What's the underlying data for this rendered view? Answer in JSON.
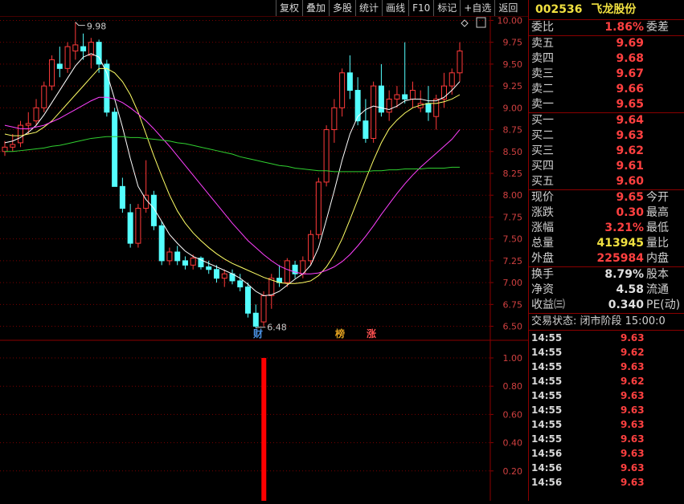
{
  "toolbar": [
    "复权",
    "叠加",
    "多股",
    "统计",
    "画线",
    "F10",
    "标记",
    "+自选",
    "返回"
  ],
  "chart": {
    "y_labels": [
      "10.00",
      "9.75",
      "9.50",
      "9.25",
      "9.00",
      "8.75",
      "8.50",
      "8.25",
      "8.00",
      "7.75",
      "7.50",
      "7.25",
      "7.00",
      "6.75",
      "6.50"
    ],
    "y_min": 6.45,
    "y_max": 10.05,
    "high_label": "9.98",
    "low_label": "6.48",
    "markers": [
      {
        "text": "财",
        "color": "#4a90e2"
      },
      {
        "text": "榜",
        "color": "#e0a020"
      },
      {
        "text": "涨",
        "color": "#ff5050"
      }
    ],
    "indicator_labels": [
      "1.00",
      "0.80",
      "0.60",
      "0.40",
      "0.20"
    ],
    "indicator_max": 1.0,
    "indicator_bar_value": 1.0,
    "indicator_color": "#ff0000",
    "ma_colors": {
      "ma5": "#ffffff",
      "ma10": "#ffff66",
      "ma20": "#ff40ff",
      "ma60": "#30d030"
    }
  },
  "chart_data": {
    "type": "candlestick",
    "note_ohlc": "open,high,low,close per session (estimated)",
    "ohlc": [
      [
        8.5,
        8.62,
        8.45,
        8.55
      ],
      [
        8.55,
        8.7,
        8.5,
        8.58
      ],
      [
        8.6,
        8.85,
        8.55,
        8.8
      ],
      [
        8.8,
        8.95,
        8.7,
        8.82
      ],
      [
        8.85,
        9.1,
        8.8,
        9.0
      ],
      [
        9.0,
        9.3,
        8.95,
        9.25
      ],
      [
        9.25,
        9.6,
        9.2,
        9.55
      ],
      [
        9.5,
        9.7,
        9.35,
        9.45
      ],
      [
        9.45,
        9.75,
        9.4,
        9.7
      ],
      [
        9.65,
        9.98,
        9.55,
        9.72
      ],
      [
        9.7,
        9.85,
        9.55,
        9.65
      ],
      [
        9.6,
        9.8,
        9.45,
        9.75
      ],
      [
        9.75,
        9.78,
        9.4,
        9.5
      ],
      [
        9.5,
        9.55,
        8.9,
        8.95
      ],
      [
        8.95,
        9.0,
        8.1,
        8.1
      ],
      [
        8.1,
        8.2,
        7.8,
        7.85
      ],
      [
        7.8,
        7.9,
        7.4,
        7.45
      ],
      [
        7.45,
        7.9,
        7.4,
        7.85
      ],
      [
        7.85,
        8.4,
        7.8,
        8.0
      ],
      [
        8.0,
        8.05,
        7.6,
        7.65
      ],
      [
        7.65,
        7.7,
        7.2,
        7.25
      ],
      [
        7.25,
        7.4,
        7.2,
        7.35
      ],
      [
        7.35,
        7.42,
        7.2,
        7.25
      ],
      [
        7.25,
        7.3,
        7.15,
        7.2
      ],
      [
        7.2,
        7.32,
        7.15,
        7.28
      ],
      [
        7.28,
        7.3,
        7.15,
        7.18
      ],
      [
        7.18,
        7.25,
        7.1,
        7.15
      ],
      [
        7.15,
        7.2,
        7.0,
        7.05
      ],
      [
        7.05,
        7.15,
        6.95,
        7.1
      ],
      [
        7.1,
        7.15,
        6.98,
        7.02
      ],
      [
        7.02,
        7.1,
        6.9,
        6.95
      ],
      [
        6.95,
        7.0,
        6.6,
        6.65
      ],
      [
        6.65,
        6.75,
        6.48,
        6.5
      ],
      [
        6.55,
        6.9,
        6.5,
        6.85
      ],
      [
        6.85,
        7.1,
        6.7,
        7.05
      ],
      [
        7.05,
        7.2,
        6.95,
        7.0
      ],
      [
        7.0,
        7.28,
        6.95,
        7.25
      ],
      [
        7.2,
        7.25,
        7.05,
        7.1
      ],
      [
        7.1,
        7.3,
        7.05,
        7.25
      ],
      [
        7.25,
        7.6,
        7.2,
        7.55
      ],
      [
        7.55,
        8.2,
        7.5,
        8.15
      ],
      [
        8.15,
        8.8,
        8.1,
        8.75
      ],
      [
        8.75,
        9.1,
        8.6,
        9.0
      ],
      [
        9.0,
        9.45,
        8.9,
        9.4
      ],
      [
        9.4,
        9.6,
        9.1,
        9.2
      ],
      [
        9.2,
        9.35,
        8.8,
        8.85
      ],
      [
        8.85,
        9.1,
        8.6,
        8.65
      ],
      [
        8.65,
        9.3,
        8.6,
        9.25
      ],
      [
        9.25,
        9.5,
        8.9,
        8.95
      ],
      [
        8.95,
        9.2,
        8.85,
        9.1
      ],
      [
        9.1,
        9.25,
        9.0,
        9.15
      ],
      [
        9.15,
        9.75,
        9.05,
        9.1
      ],
      [
        9.1,
        9.3,
        9.0,
        9.2
      ],
      [
        9.0,
        9.2,
        8.95,
        9.05
      ],
      [
        9.05,
        9.25,
        8.85,
        8.95
      ],
      [
        8.9,
        9.15,
        8.75,
        9.1
      ],
      [
        9.1,
        9.4,
        9.0,
        9.25
      ],
      [
        9.25,
        9.45,
        9.15,
        9.4
      ],
      [
        9.4,
        9.75,
        9.3,
        9.65
      ]
    ],
    "ma_series": [
      {
        "id": "ma5",
        "values": [
          8.6,
          8.62,
          8.66,
          8.72,
          8.8,
          8.92,
          9.06,
          9.2,
          9.34,
          9.48,
          9.58,
          9.62,
          9.58,
          9.4,
          9.1,
          8.78,
          8.42,
          8.1,
          7.95,
          7.85,
          7.7,
          7.55,
          7.45,
          7.36,
          7.3,
          7.26,
          7.22,
          7.18,
          7.14,
          7.1,
          7.05,
          6.98,
          6.9,
          6.85,
          6.86,
          6.9,
          6.97,
          7.04,
          7.1,
          7.2,
          7.4,
          7.72,
          8.05,
          8.4,
          8.7,
          8.9,
          8.98,
          9.02,
          9.0,
          8.98,
          9.02,
          9.08,
          9.1,
          9.1,
          9.08,
          9.08,
          9.12,
          9.2,
          9.3
        ]
      },
      {
        "id": "ma10",
        "values": [
          8.7,
          8.68,
          8.68,
          8.7,
          8.72,
          8.78,
          8.85,
          8.95,
          9.05,
          9.15,
          9.25,
          9.35,
          9.45,
          9.45,
          9.4,
          9.3,
          9.15,
          8.95,
          8.7,
          8.45,
          8.22,
          8.0,
          7.82,
          7.68,
          7.57,
          7.48,
          7.4,
          7.33,
          7.27,
          7.22,
          7.18,
          7.14,
          7.1,
          7.06,
          7.03,
          7.0,
          6.99,
          6.99,
          7.0,
          7.02,
          7.08,
          7.18,
          7.32,
          7.5,
          7.72,
          7.95,
          8.18,
          8.4,
          8.6,
          8.76,
          8.86,
          8.94,
          9.0,
          9.03,
          9.05,
          9.05,
          9.07,
          9.1,
          9.15
        ]
      },
      {
        "id": "ma20",
        "values": [
          8.8,
          8.78,
          8.76,
          8.76,
          8.78,
          8.8,
          8.84,
          8.88,
          8.93,
          8.98,
          9.03,
          9.08,
          9.12,
          9.12,
          9.1,
          9.06,
          9.0,
          8.93,
          8.85,
          8.76,
          8.66,
          8.56,
          8.45,
          8.34,
          8.23,
          8.12,
          8.01,
          7.9,
          7.79,
          7.68,
          7.58,
          7.48,
          7.4,
          7.32,
          7.25,
          7.19,
          7.15,
          7.12,
          7.1,
          7.1,
          7.11,
          7.14,
          7.18,
          7.24,
          7.32,
          7.42,
          7.53,
          7.65,
          7.78,
          7.9,
          8.02,
          8.13,
          8.23,
          8.32,
          8.4,
          8.48,
          8.56,
          8.64,
          8.75
        ]
      },
      {
        "id": "ma60",
        "values": [
          8.5,
          8.5,
          8.51,
          8.52,
          8.53,
          8.54,
          8.56,
          8.57,
          8.59,
          8.61,
          8.63,
          8.65,
          8.66,
          8.67,
          8.67,
          8.67,
          8.66,
          8.66,
          8.65,
          8.64,
          8.63,
          8.62,
          8.6,
          8.59,
          8.57,
          8.55,
          8.53,
          8.51,
          8.49,
          8.47,
          8.44,
          8.42,
          8.4,
          8.38,
          8.36,
          8.34,
          8.33,
          8.31,
          8.3,
          8.29,
          8.28,
          8.28,
          8.27,
          8.27,
          8.27,
          8.27,
          8.27,
          8.28,
          8.28,
          8.29,
          8.29,
          8.3,
          8.3,
          8.3,
          8.31,
          8.31,
          8.31,
          8.32,
          8.32
        ]
      }
    ]
  },
  "stock": {
    "code": "002536",
    "name": "飞龙股份"
  },
  "ratio": {
    "label": "委比",
    "value": "1.86%",
    "label2": "委差"
  },
  "sells": [
    {
      "label": "卖五",
      "price": "9.69"
    },
    {
      "label": "卖四",
      "price": "9.68"
    },
    {
      "label": "卖三",
      "price": "9.67"
    },
    {
      "label": "卖二",
      "price": "9.66"
    },
    {
      "label": "卖一",
      "price": "9.65"
    }
  ],
  "buys": [
    {
      "label": "买一",
      "price": "9.64"
    },
    {
      "label": "买二",
      "price": "9.63"
    },
    {
      "label": "买三",
      "price": "9.62"
    },
    {
      "label": "买四",
      "price": "9.61"
    },
    {
      "label": "买五",
      "price": "9.60"
    }
  ],
  "quote": [
    {
      "label": "现价",
      "value": "9.65",
      "label2": "今开",
      "cls": "red"
    },
    {
      "label": "涨跌",
      "value": "0.30",
      "label2": "最高",
      "cls": "red"
    },
    {
      "label": "涨幅",
      "value": "3.21%",
      "label2": "最低",
      "cls": "red"
    },
    {
      "label": "总量",
      "value": "413945",
      "label2": "量比",
      "cls": "yel"
    },
    {
      "label": "外盘",
      "value": "225984",
      "label2": "内盘",
      "cls": "red"
    }
  ],
  "fund": [
    {
      "label": "换手",
      "value": "8.79%",
      "label2": "股本"
    },
    {
      "label": "净资",
      "value": "4.58",
      "label2": "流通"
    },
    {
      "label": "收益㈢",
      "value": "0.340",
      "label2": "PE(动)"
    }
  ],
  "status": {
    "text": "交易状态: 闭市阶段 15:00:0"
  },
  "ticks": [
    {
      "time": "14:55",
      "price": "9.63"
    },
    {
      "time": "14:55",
      "price": "9.62"
    },
    {
      "time": "14:55",
      "price": "9.63"
    },
    {
      "time": "14:55",
      "price": "9.62"
    },
    {
      "time": "14:55",
      "price": "9.63"
    },
    {
      "time": "14:55",
      "price": "9.63"
    },
    {
      "time": "14:55",
      "price": "9.63"
    },
    {
      "time": "14:55",
      "price": "9.63"
    },
    {
      "time": "14:56",
      "price": "9.63"
    },
    {
      "time": "14:56",
      "price": "9.63"
    },
    {
      "time": "14:56",
      "price": "9.63"
    }
  ]
}
